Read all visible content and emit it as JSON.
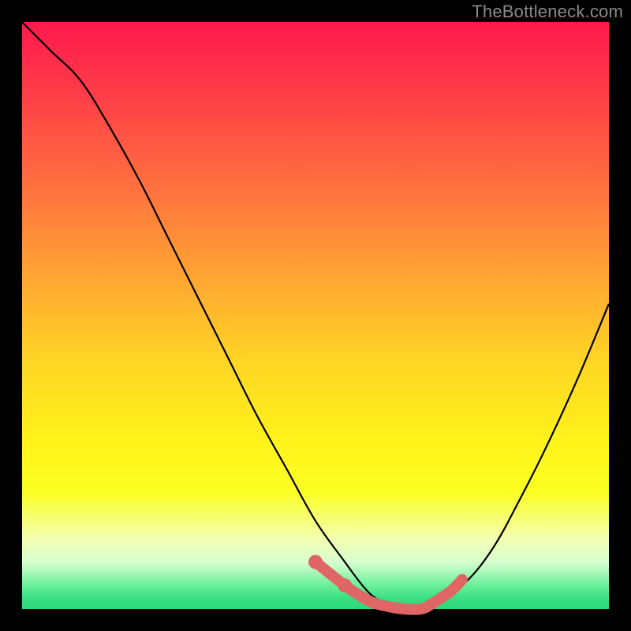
{
  "watermark": "TheBottleneck.com",
  "colors": {
    "background": "#000000",
    "curve": "#000000",
    "highlight": "#e06666",
    "gradient_top": "#ff1a4d",
    "gradient_bottom": "#2cd878"
  },
  "chart_data": {
    "type": "line",
    "title": "",
    "xlabel": "",
    "ylabel": "",
    "xlim": [
      0,
      100
    ],
    "ylim": [
      0,
      100
    ],
    "x": [
      0,
      5,
      10,
      15,
      20,
      25,
      30,
      35,
      40,
      45,
      50,
      55,
      58,
      60,
      62,
      65,
      68,
      70,
      75,
      80,
      85,
      90,
      95,
      100
    ],
    "values": [
      100,
      95,
      90,
      82,
      73,
      63,
      53,
      43,
      33,
      24,
      15,
      8,
      4,
      2,
      1,
      0,
      0,
      1,
      4,
      10,
      19,
      29,
      40,
      52
    ],
    "highlight": {
      "x": [
        50,
        55,
        58,
        60,
        62,
        65,
        68,
        70,
        73,
        75
      ],
      "values": [
        8,
        4,
        2,
        1,
        0.5,
        0,
        0,
        1,
        3,
        5
      ]
    },
    "annotations": []
  }
}
